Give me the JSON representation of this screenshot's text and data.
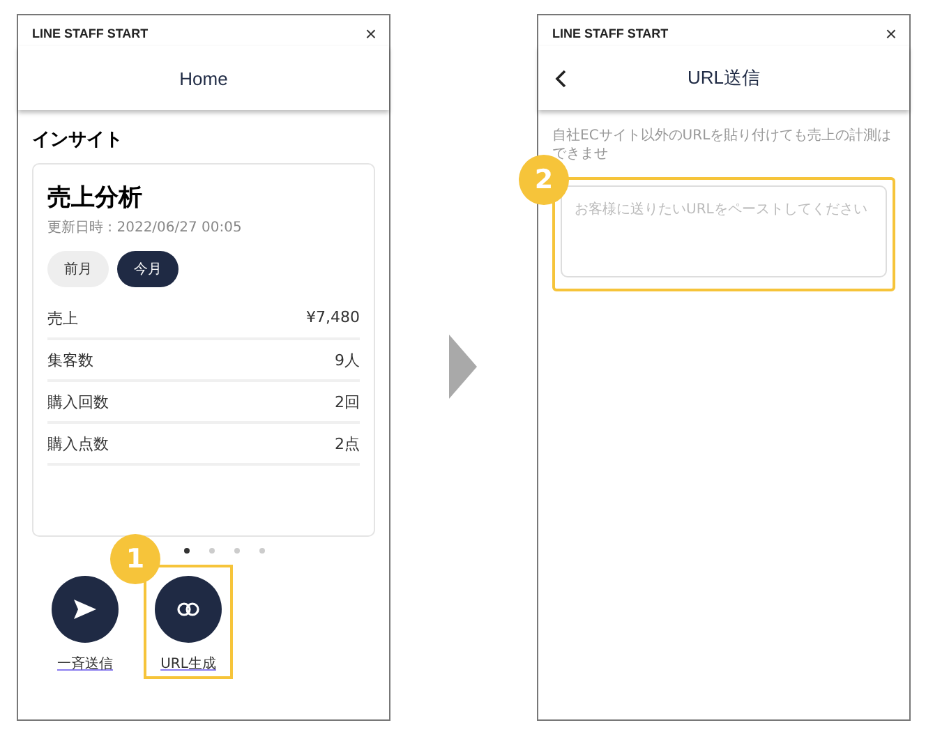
{
  "screens": [
    {
      "app_title": "LINE STAFF START",
      "close": "×",
      "nav_title": "Home",
      "back": false,
      "section_title": "インサイト",
      "card": {
        "title": "売上分析",
        "updated": "更新日時 : 2022/06/27 00:05",
        "periods": [
          {
            "label": "前月",
            "selected": false
          },
          {
            "label": "今月",
            "selected": true
          }
        ],
        "rows": [
          {
            "label": "売上",
            "value": "¥7,480"
          },
          {
            "label": "集客数",
            "value": "9人"
          },
          {
            "label": "購入回数",
            "value": "2回"
          },
          {
            "label": "購入点数",
            "value": "2点"
          }
        ]
      },
      "dots": [
        {
          "selected": true
        },
        {
          "selected": false
        },
        {
          "selected": false
        },
        {
          "selected": false
        }
      ],
      "actions": [
        {
          "kind": "send",
          "label": "一斉送信",
          "highlighted": false
        },
        {
          "kind": "link",
          "label": "URL生成",
          "highlighted": true,
          "step": "1"
        }
      ]
    },
    {
      "app_title": "LINE STAFF START",
      "close": "×",
      "nav_title": "URL送信",
      "back": true,
      "notice": "自社ECサイト以外のURLを貼り付けても売上の計測はできませ",
      "url_field": {
        "placeholder": "お客様に送りたいURLをペーストしてください",
        "highlighted": true,
        "step": "2"
      }
    }
  ]
}
